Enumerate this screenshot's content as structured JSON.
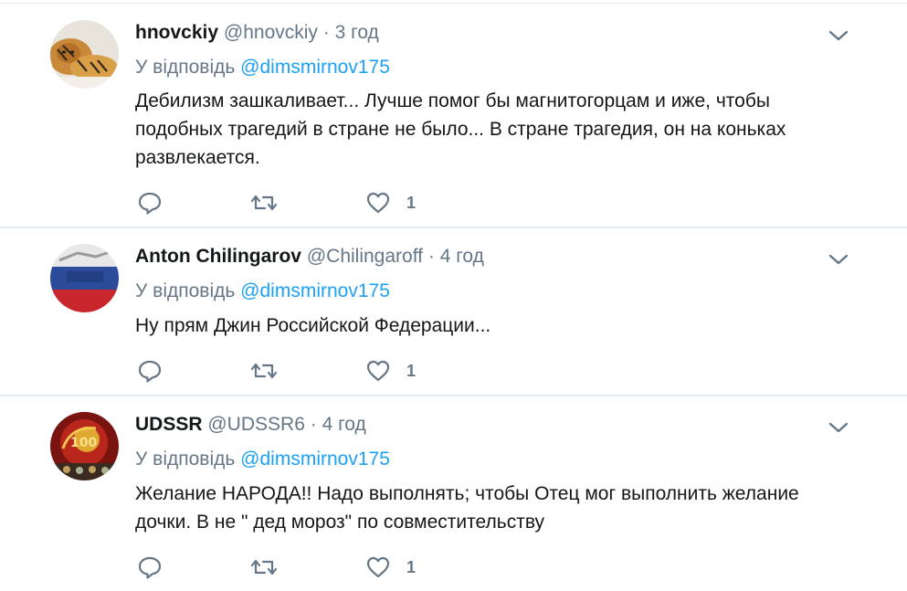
{
  "tweets": [
    {
      "name": "hnovckiy",
      "username": "@hnovckiy",
      "separator": "·",
      "time": "3 год",
      "reply_prefix": "У відповідь",
      "reply_to": "@dimsmirnov175",
      "text_lines": [
        "Дебилизм зашкаливает... Лучше помог бы магнитогорцам и иже, чтобы",
        "подобных трагедий в стране не было... В стране трагедия, он на коньках",
        "развлекается."
      ],
      "likes": "1",
      "avatar_icon": "tiger-avatar"
    },
    {
      "name": "Anton Chilingarov",
      "username": "@Chilingaroff",
      "separator": "·",
      "time": "4 год",
      "reply_prefix": "У відповідь",
      "reply_to": "@dimsmirnov175",
      "text_lines": [
        "Ну прям Джин Российской Федерации..."
      ],
      "likes": "1",
      "avatar_icon": "russian-flag-avatar"
    },
    {
      "name": "UDSSR",
      "username": "@UDSSR6",
      "separator": "·",
      "time": "4 год",
      "reply_prefix": "У відповідь",
      "reply_to": "@dimsmirnov175",
      "text_lines": [
        "Желание НАРОДА!! Надо выполнять; чтобы Отец мог выполнить желание",
        "дочки. В не \" дед мороз\" по совместительству"
      ],
      "likes": "1",
      "avatar_icon": "soviet-emblem-avatar"
    }
  ],
  "colors": {
    "link": "#1da1f2",
    "secondary_text": "#657786",
    "divider": "#e6ecf0",
    "primary_text": "#14171a"
  }
}
